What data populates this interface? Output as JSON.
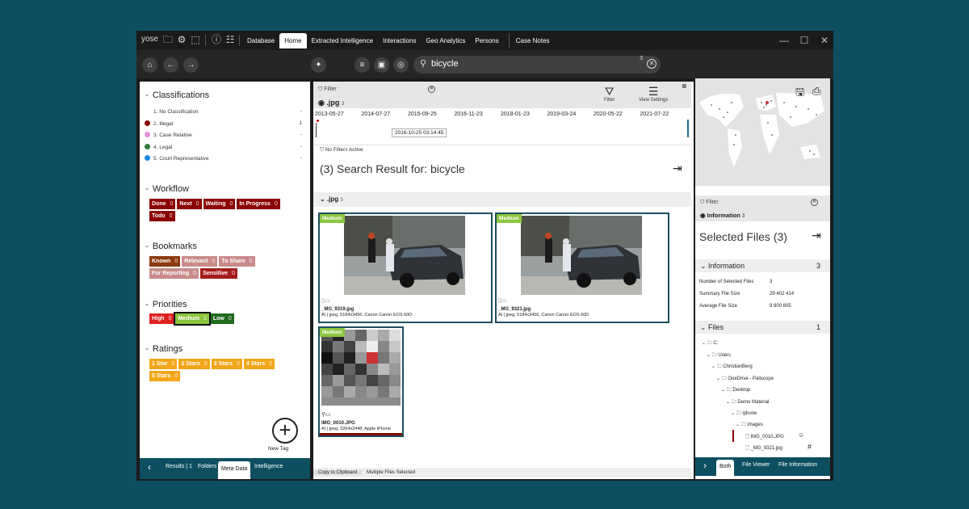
{
  "app": {
    "logo": "yose"
  },
  "menu": {
    "tabs": [
      "Database",
      "Home",
      "Extracted Intelligence",
      "Interactions",
      "Geo Analytics",
      "Persons",
      "Case Notes"
    ]
  },
  "search": {
    "query": "bicycle",
    "count": "3"
  },
  "classifications": {
    "title": "Classifications",
    "items": [
      {
        "label": "1. No Classification",
        "count": "-",
        "color": ""
      },
      {
        "label": "2. Illegal",
        "count": "1",
        "color": "#8b0000"
      },
      {
        "label": "3. Case Relative",
        "count": "-",
        "color": "#e58fd9"
      },
      {
        "label": "4. Legal",
        "count": "-",
        "color": "#2e7d32"
      },
      {
        "label": "5. Court Representative",
        "count": "-",
        "color": "#1e88e5"
      }
    ]
  },
  "workflow": {
    "title": "Workflow",
    "tags": [
      {
        "label": "Done",
        "count": "0",
        "color": "#8b0000"
      },
      {
        "label": "Next",
        "count": "0",
        "color": "#8b0000"
      },
      {
        "label": "Waiting",
        "count": "0",
        "color": "#8b0000"
      },
      {
        "label": "In Progress",
        "count": "0",
        "color": "#8b0000"
      },
      {
        "label": "Todo",
        "count": "0",
        "color": "#8b0000"
      }
    ]
  },
  "bookmarks": {
    "title": "Bookmarks",
    "tags": [
      {
        "label": "Known",
        "count": "0",
        "color": "#8b3a0e"
      },
      {
        "label": "Relevant",
        "count": "0",
        "color": "#c98a8a"
      },
      {
        "label": "To Share",
        "count": "0",
        "color": "#c98a8a"
      },
      {
        "label": "For Reporting",
        "count": "0",
        "color": "#c98a8a"
      },
      {
        "label": "Sensitive",
        "count": "0",
        "color": "#a51c1c"
      }
    ]
  },
  "priorities": {
    "title": "Priorities",
    "tags": [
      {
        "label": "High",
        "count": "0",
        "color": "#e02020"
      },
      {
        "label": "Medium",
        "count": "3",
        "color": "#8dc63f"
      },
      {
        "label": "Low",
        "count": "0",
        "color": "#1f6b1f"
      }
    ]
  },
  "ratings": {
    "title": "Ratings",
    "tags": [
      {
        "label": "1 Star",
        "count": "0",
        "color": "#f2a61a"
      },
      {
        "label": "2 Stars",
        "count": "0",
        "color": "#f2a61a"
      },
      {
        "label": "3 Stars",
        "count": "0",
        "color": "#f2a61a"
      },
      {
        "label": "4 Stars",
        "count": "0",
        "color": "#f2a61a"
      },
      {
        "label": "5 Stars",
        "count": "0",
        "color": "#f2a61a"
      }
    ]
  },
  "new_tag": {
    "label": "New Tag"
  },
  "left_tabs": [
    "Results | 1",
    "Folders",
    "Meta Data",
    "Intelligence"
  ],
  "center": {
    "filter_label": "Filter",
    "ext": ".jpg",
    "ext_count": "3",
    "filter_tool": "Filter",
    "view_settings": "View Settings",
    "timeline": [
      "2013-05-27",
      "2014-07-27",
      "2015-09-25",
      "2016-11-23",
      "2018-01-23",
      "2019-03-24",
      "2020-05-22",
      "2021-07-22"
    ],
    "timeline_tip": "2016-10-25 03:14:45",
    "no_filters": "No Filters Active",
    "result_title": "(3) Search Result for: bicycle",
    "group_label": ".jpg",
    "group_count": "3",
    "cards": [
      {
        "badge": "Medium",
        "name": "_MG_9319.jpg",
        "info": "AI | jpeg, 5184x3456, Canon Canon EOS 60D"
      },
      {
        "badge": "Medium",
        "name": "_MG_9321.jpg",
        "info": "AI | jpeg, 5184x3456, Canon Canon EOS 60D"
      },
      {
        "badge": "Medium",
        "name": "IMG_0010.JPG",
        "info": "AI | jpeg, 3264x2448, Apple iPhone"
      }
    ],
    "copy_btn": "Copy to Clipboard",
    "status": "Multiple Files Selected"
  },
  "right": {
    "filter_label": "Filter",
    "information_label": "Information",
    "information_count": "3",
    "selected_title": "Selected Files (3)",
    "info_section": "Information",
    "info_section_count": "3",
    "info_rows": [
      {
        "k": "Number of Selected Files",
        "v": "3"
      },
      {
        "k": "Summary File Size",
        "v": "29 402 414"
      },
      {
        "k": "Average File Size",
        "v": "9 800 805"
      }
    ],
    "files_section": "Files",
    "files_section_count": "1",
    "tree": [
      "C:",
      "Users",
      "ChristianBerg",
      "OneDrive - Paliscope",
      "Desktop",
      "Demo Material",
      "iphone",
      "images",
      "IMG_0010.JPG",
      "_MG_9321.jpg"
    ],
    "tabs": [
      "Both",
      "File Viewer",
      "File Information"
    ]
  }
}
